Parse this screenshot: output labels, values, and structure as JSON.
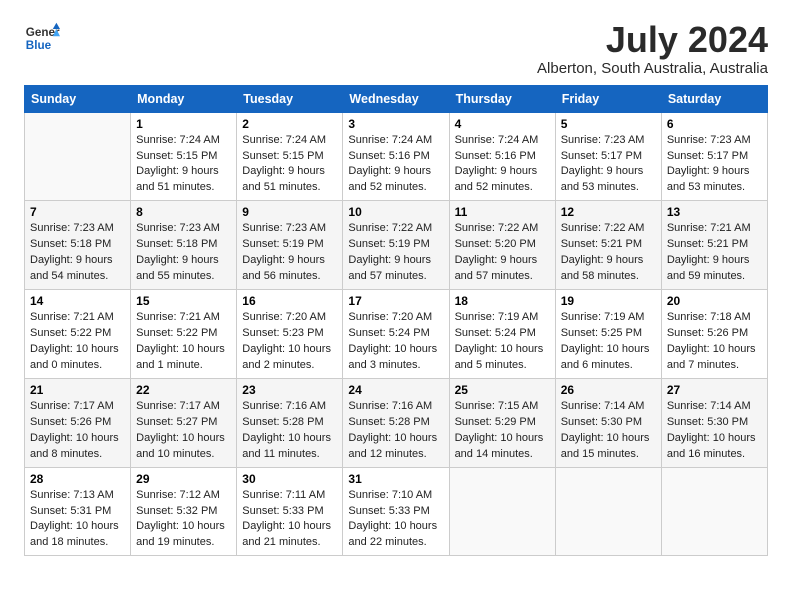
{
  "logo": {
    "line1": "General",
    "line2": "Blue"
  },
  "title": "July 2024",
  "location": "Alberton, South Australia, Australia",
  "weekdays": [
    "Sunday",
    "Monday",
    "Tuesday",
    "Wednesday",
    "Thursday",
    "Friday",
    "Saturday"
  ],
  "weeks": [
    [
      {
        "date": "",
        "info": ""
      },
      {
        "date": "1",
        "info": "Sunrise: 7:24 AM\nSunset: 5:15 PM\nDaylight: 9 hours\nand 51 minutes."
      },
      {
        "date": "2",
        "info": "Sunrise: 7:24 AM\nSunset: 5:15 PM\nDaylight: 9 hours\nand 51 minutes."
      },
      {
        "date": "3",
        "info": "Sunrise: 7:24 AM\nSunset: 5:16 PM\nDaylight: 9 hours\nand 52 minutes."
      },
      {
        "date": "4",
        "info": "Sunrise: 7:24 AM\nSunset: 5:16 PM\nDaylight: 9 hours\nand 52 minutes."
      },
      {
        "date": "5",
        "info": "Sunrise: 7:23 AM\nSunset: 5:17 PM\nDaylight: 9 hours\nand 53 minutes."
      },
      {
        "date": "6",
        "info": "Sunrise: 7:23 AM\nSunset: 5:17 PM\nDaylight: 9 hours\nand 53 minutes."
      }
    ],
    [
      {
        "date": "7",
        "info": "Sunrise: 7:23 AM\nSunset: 5:18 PM\nDaylight: 9 hours\nand 54 minutes."
      },
      {
        "date": "8",
        "info": "Sunrise: 7:23 AM\nSunset: 5:18 PM\nDaylight: 9 hours\nand 55 minutes."
      },
      {
        "date": "9",
        "info": "Sunrise: 7:23 AM\nSunset: 5:19 PM\nDaylight: 9 hours\nand 56 minutes."
      },
      {
        "date": "10",
        "info": "Sunrise: 7:22 AM\nSunset: 5:19 PM\nDaylight: 9 hours\nand 57 minutes."
      },
      {
        "date": "11",
        "info": "Sunrise: 7:22 AM\nSunset: 5:20 PM\nDaylight: 9 hours\nand 57 minutes."
      },
      {
        "date": "12",
        "info": "Sunrise: 7:22 AM\nSunset: 5:21 PM\nDaylight: 9 hours\nand 58 minutes."
      },
      {
        "date": "13",
        "info": "Sunrise: 7:21 AM\nSunset: 5:21 PM\nDaylight: 9 hours\nand 59 minutes."
      }
    ],
    [
      {
        "date": "14",
        "info": "Sunrise: 7:21 AM\nSunset: 5:22 PM\nDaylight: 10 hours\nand 0 minutes."
      },
      {
        "date": "15",
        "info": "Sunrise: 7:21 AM\nSunset: 5:22 PM\nDaylight: 10 hours\nand 1 minute."
      },
      {
        "date": "16",
        "info": "Sunrise: 7:20 AM\nSunset: 5:23 PM\nDaylight: 10 hours\nand 2 minutes."
      },
      {
        "date": "17",
        "info": "Sunrise: 7:20 AM\nSunset: 5:24 PM\nDaylight: 10 hours\nand 3 minutes."
      },
      {
        "date": "18",
        "info": "Sunrise: 7:19 AM\nSunset: 5:24 PM\nDaylight: 10 hours\nand 5 minutes."
      },
      {
        "date": "19",
        "info": "Sunrise: 7:19 AM\nSunset: 5:25 PM\nDaylight: 10 hours\nand 6 minutes."
      },
      {
        "date": "20",
        "info": "Sunrise: 7:18 AM\nSunset: 5:26 PM\nDaylight: 10 hours\nand 7 minutes."
      }
    ],
    [
      {
        "date": "21",
        "info": "Sunrise: 7:17 AM\nSunset: 5:26 PM\nDaylight: 10 hours\nand 8 minutes."
      },
      {
        "date": "22",
        "info": "Sunrise: 7:17 AM\nSunset: 5:27 PM\nDaylight: 10 hours\nand 10 minutes."
      },
      {
        "date": "23",
        "info": "Sunrise: 7:16 AM\nSunset: 5:28 PM\nDaylight: 10 hours\nand 11 minutes."
      },
      {
        "date": "24",
        "info": "Sunrise: 7:16 AM\nSunset: 5:28 PM\nDaylight: 10 hours\nand 12 minutes."
      },
      {
        "date": "25",
        "info": "Sunrise: 7:15 AM\nSunset: 5:29 PM\nDaylight: 10 hours\nand 14 minutes."
      },
      {
        "date": "26",
        "info": "Sunrise: 7:14 AM\nSunset: 5:30 PM\nDaylight: 10 hours\nand 15 minutes."
      },
      {
        "date": "27",
        "info": "Sunrise: 7:14 AM\nSunset: 5:30 PM\nDaylight: 10 hours\nand 16 minutes."
      }
    ],
    [
      {
        "date": "28",
        "info": "Sunrise: 7:13 AM\nSunset: 5:31 PM\nDaylight: 10 hours\nand 18 minutes."
      },
      {
        "date": "29",
        "info": "Sunrise: 7:12 AM\nSunset: 5:32 PM\nDaylight: 10 hours\nand 19 minutes."
      },
      {
        "date": "30",
        "info": "Sunrise: 7:11 AM\nSunset: 5:33 PM\nDaylight: 10 hours\nand 21 minutes."
      },
      {
        "date": "31",
        "info": "Sunrise: 7:10 AM\nSunset: 5:33 PM\nDaylight: 10 hours\nand 22 minutes."
      },
      {
        "date": "",
        "info": ""
      },
      {
        "date": "",
        "info": ""
      },
      {
        "date": "",
        "info": ""
      }
    ]
  ]
}
